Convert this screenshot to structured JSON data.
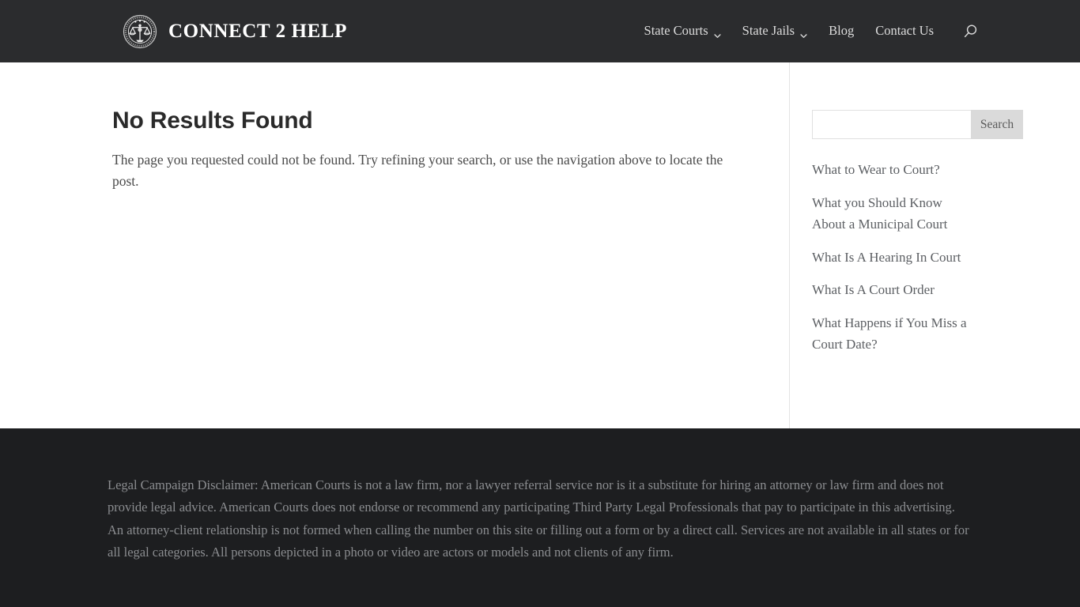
{
  "header": {
    "logo_icon": "scales-of-justice-emblem",
    "brand_text": "CONNECT 2 HELP",
    "nav": [
      {
        "label": "State Courts",
        "has_dropdown": true,
        "icon": "chevron-down-icon"
      },
      {
        "label": "State Jails",
        "has_dropdown": true,
        "icon": "chevron-down-icon"
      },
      {
        "label": "Blog",
        "has_dropdown": false
      },
      {
        "label": "Contact Us",
        "has_dropdown": false
      }
    ],
    "search_icon": "search-icon",
    "background_color": "#2b2c2e",
    "text_color": "#dcdcdc"
  },
  "main": {
    "title": "No Results Found",
    "body": "The page you requested could not be found. Try refining your search, or use the navigation above to locate the post."
  },
  "sidebar": {
    "search": {
      "value": "",
      "placeholder": "",
      "button_label": "Search",
      "button_color": "#dadada"
    },
    "links": [
      {
        "label": "What to Wear to Court?"
      },
      {
        "label": "What you Should Know About a Municipal Court"
      },
      {
        "label": "What Is A Hearing In Court"
      },
      {
        "label": "What Is A Court Order"
      },
      {
        "label": "What Happens if You Miss a Court Date?"
      }
    ]
  },
  "footer": {
    "disclaimer": "Legal Campaign Disclaimer: American Courts is not a law firm, nor a lawyer referral service nor is it a substitute for hiring an attorney or law firm and does not provide legal advice. American Courts does not endorse or recommend any participating Third Party Legal Professionals that pay to participate in this advertising. An attorney-client relationship is not formed when calling the number on this site or filling out a form or by a direct call. Services are not available in all states or for all legal categories. All persons depicted in a photo or video are actors or models and not clients of any firm.",
    "background_color": "#1d1e20",
    "text_color": "#8b8d90"
  }
}
